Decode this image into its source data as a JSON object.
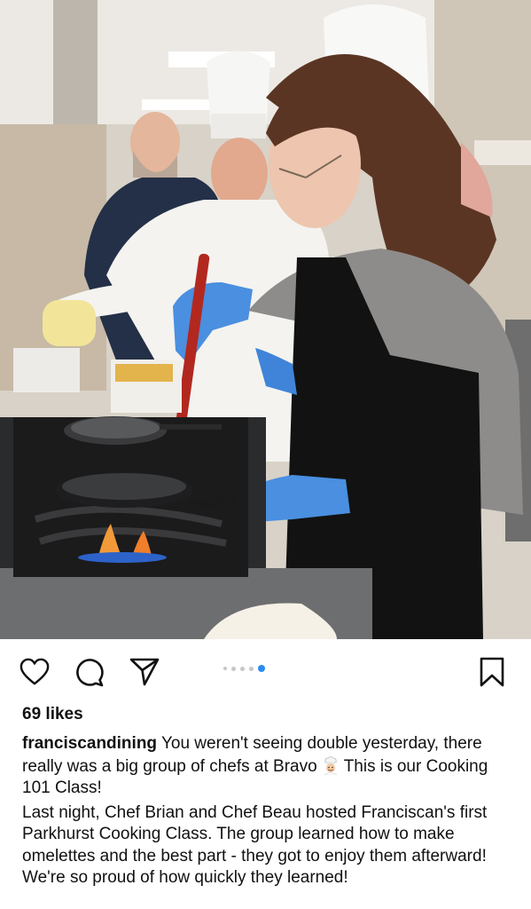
{
  "post": {
    "image_description_icon": "photo",
    "carousel": {
      "total": 5,
      "active_index": 4
    }
  },
  "actions": {
    "like_icon": "heart-icon",
    "comment_icon": "comment-icon",
    "share_icon": "paper-plane-icon",
    "save_icon": "bookmark-icon"
  },
  "likes_text": "69 likes",
  "caption": {
    "username": "franciscandining",
    "line1_before_emoji": "You weren't seeing double yesterday, there really was a big group of chefs at Bravo",
    "emoji_icon": "cook-emoji",
    "line1_after_emoji": "This is our Cooking 101 Class!",
    "paragraph2": "Last night, Chef Brian and Chef Beau hosted Franciscan's first Parkhurst Cooking Class. The group learned how to make omelettes and the best part - they got to enjoy them afterward! We're so proud of how quickly they learned!"
  },
  "colors": {
    "accent_dot": "#2a8cf0",
    "inactive_dot": "#c7c7c7",
    "text": "#111111",
    "glove_blue": "#4a8fe0"
  }
}
